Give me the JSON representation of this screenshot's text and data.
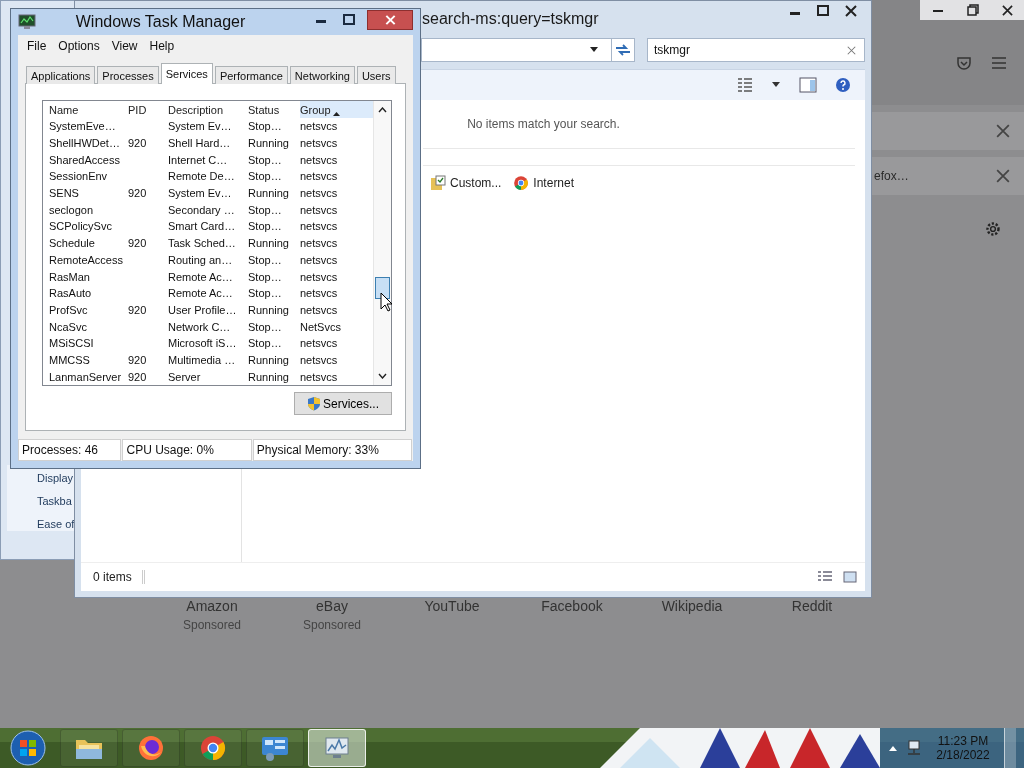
{
  "firefox": {
    "notifications": [
      {
        "closable": true
      },
      {
        "text": "efox…",
        "closable": true
      }
    ],
    "sites": [
      {
        "name": "Amazon",
        "note": "Sponsored"
      },
      {
        "name": "eBay",
        "note": "Sponsored"
      },
      {
        "name": "YouTube"
      },
      {
        "name": "Facebook"
      },
      {
        "name": "Wikipedia"
      },
      {
        "name": "Reddit"
      }
    ]
  },
  "control_panel": {
    "items": [
      "Display",
      "Taskba",
      "Ease of"
    ]
  },
  "explorer": {
    "title": "search-ms:query=tskmgr",
    "search": {
      "value": "tskmgr"
    },
    "message": "No items match your search.",
    "search_again": [
      {
        "kind": "library",
        "label": "Custom..."
      },
      {
        "kind": "browser",
        "label": "Internet"
      }
    ],
    "status": "0 items"
  },
  "task_manager": {
    "title": "Windows Task Manager",
    "menu": [
      "File",
      "Options",
      "View",
      "Help"
    ],
    "tabs": [
      {
        "label": "Applications",
        "selected": false
      },
      {
        "label": "Processes",
        "selected": false
      },
      {
        "label": "Services",
        "selected": true
      },
      {
        "label": "Performance",
        "selected": false
      },
      {
        "label": "Networking",
        "selected": false
      },
      {
        "label": "Users",
        "selected": false
      }
    ],
    "columns": [
      {
        "label": "Name",
        "sorted": false
      },
      {
        "label": "PID",
        "sorted": false
      },
      {
        "label": "Description",
        "sorted": false
      },
      {
        "label": "Status",
        "sorted": false
      },
      {
        "label": "Group",
        "sorted": true
      }
    ],
    "rows": [
      {
        "name": "SystemEve…",
        "description": "System Ev…",
        "status": "Stop…",
        "group": "netsvcs"
      },
      {
        "name": "ShellHWDet…",
        "pid": "920",
        "description": "Shell Hard…",
        "status": "Running",
        "group": "netsvcs"
      },
      {
        "name": "SharedAccess",
        "description": "Internet C…",
        "status": "Stop…",
        "group": "netsvcs"
      },
      {
        "name": "SessionEnv",
        "description": "Remote De…",
        "status": "Stop…",
        "group": "netsvcs"
      },
      {
        "name": "SENS",
        "pid": "920",
        "description": "System Ev…",
        "status": "Running",
        "group": "netsvcs"
      },
      {
        "name": "seclogon",
        "description": "Secondary …",
        "status": "Stop…",
        "group": "netsvcs"
      },
      {
        "name": "SCPolicySvc",
        "description": "Smart Card…",
        "status": "Stop…",
        "group": "netsvcs"
      },
      {
        "name": "Schedule",
        "pid": "920",
        "description": "Task Sched…",
        "status": "Running",
        "group": "netsvcs"
      },
      {
        "name": "RemoteAccess",
        "description": "Routing an…",
        "status": "Stop…",
        "group": "netsvcs"
      },
      {
        "name": "RasMan",
        "description": "Remote Ac…",
        "status": "Stop…",
        "group": "netsvcs"
      },
      {
        "name": "RasAuto",
        "description": "Remote Ac…",
        "status": "Stop…",
        "group": "netsvcs"
      },
      {
        "name": "ProfSvc",
        "pid": "920",
        "description": "User Profile…",
        "status": "Running",
        "group": "netsvcs"
      },
      {
        "name": "NcaSvc",
        "description": "Network C…",
        "status": "Stop…",
        "group": "NetSvcs"
      },
      {
        "name": "MSiSCSI",
        "description": "Microsoft iS…",
        "status": "Stop…",
        "group": "netsvcs"
      },
      {
        "name": "MMCSS",
        "pid": "920",
        "description": "Multimedia …",
        "status": "Running",
        "group": "netsvcs"
      },
      {
        "name": "LanmanServer",
        "pid": "920",
        "description": "Server",
        "status": "Running",
        "group": "netsvcs"
      }
    ],
    "button": "Services...",
    "status_bar": [
      "Processes: 46",
      "CPU Usage: 0%",
      "Physical Memory: 33%"
    ]
  },
  "taskbar": {
    "apps": [
      {
        "kind": "folder",
        "selected": false
      },
      {
        "kind": "firefox",
        "selected": false
      },
      {
        "kind": "chrome",
        "selected": false
      },
      {
        "kind": "control-panel",
        "selected": false
      },
      {
        "kind": "monitor",
        "selected": true
      }
    ],
    "clock": {
      "time": "11:23 PM",
      "date": "2/18/2022"
    }
  }
}
